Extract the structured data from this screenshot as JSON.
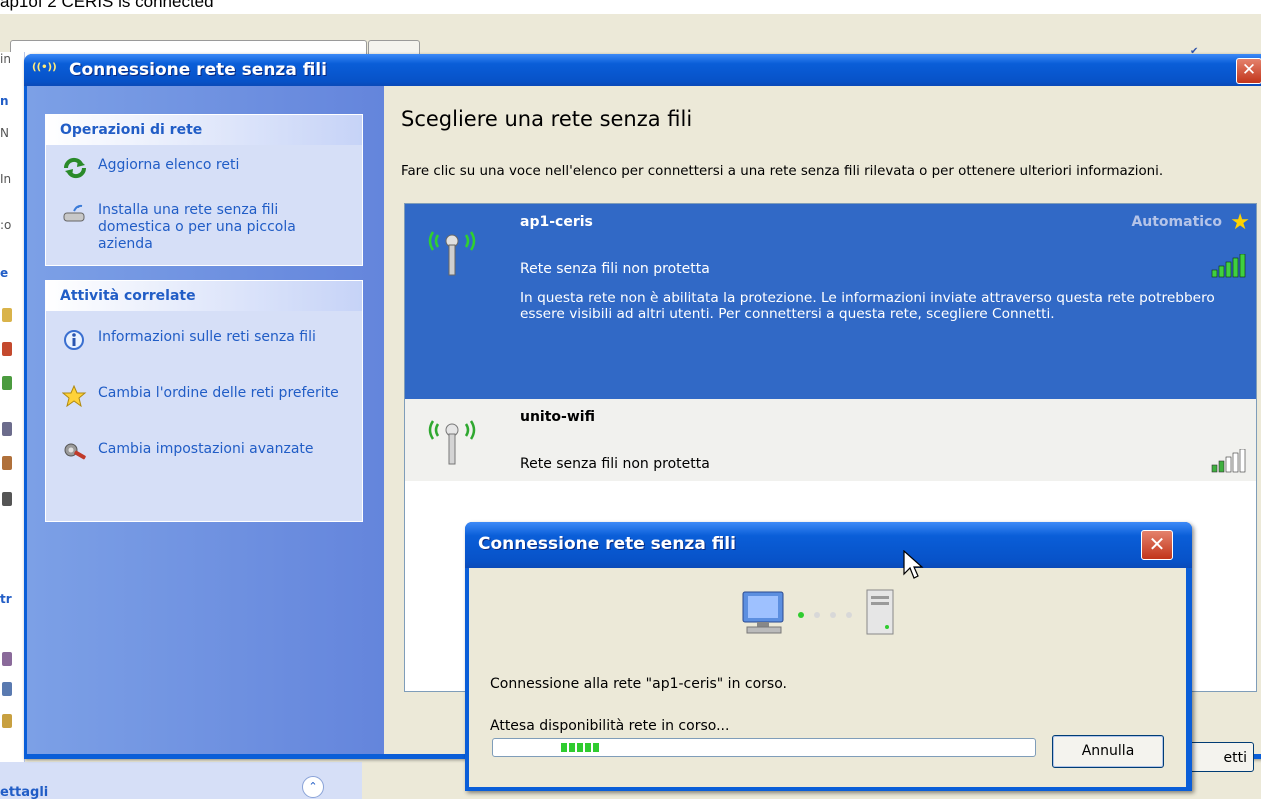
{
  "caption": "ap1of 2 CERIS is connected",
  "background": {
    "fragments": [
      "in",
      "n",
      "N",
      "In",
      ":o",
      "e",
      "tr"
    ],
    "bottom_label": "ettagli",
    "chevron": "⌃"
  },
  "window": {
    "title": "Connessione rete senza fili",
    "close": "✕",
    "sidebar": {
      "groups": [
        {
          "title": "Operazioni di rete",
          "items": [
            {
              "label": "Aggiorna elenco reti",
              "icon": "refresh-icon"
            },
            {
              "label": "Installa una rete senza fili domestica o per una piccola azienda",
              "icon": "setup-wireless-icon"
            }
          ]
        },
        {
          "title": "Attività correlate",
          "items": [
            {
              "label": "Informazioni sulle reti senza fili",
              "icon": "info-icon"
            },
            {
              "label": "Cambia l'ordine delle reti preferite",
              "icon": "star-icon"
            },
            {
              "label": "Cambia impostazioni avanzate",
              "icon": "settings-tools-icon"
            }
          ]
        }
      ]
    },
    "main": {
      "heading": "Scegliere una rete senza fili",
      "instructions": "Fare clic su una voce nell'elenco per connettersi a una rete senza fili rilevata o per ottenere ulteriori informazioni.",
      "networks": [
        {
          "name": "ap1-ceris",
          "status": "Rete senza fili non protetta",
          "connection_mode": "Automatico",
          "description": "In questa rete non è abilitata la protezione. Le informazioni inviate attraverso questa rete potrebbero essere visibili ad altri utenti. Per connettersi a questa rete, scegliere Connetti.",
          "signal_bars": 5,
          "selected": true
        },
        {
          "name": "unito-wifi",
          "status": "Rete senza fili non protetta",
          "signal_bars": 2,
          "selected": false
        }
      ],
      "connect_button": "etti"
    }
  },
  "dialog": {
    "title": "Connessione rete senza fili",
    "close": "✕",
    "message": "Connessione alla rete \"ap1-ceris\" in corso.",
    "status": "Attesa disponibilità rete in corso...",
    "cancel_label": "Annulla",
    "progress_segments": 5
  },
  "colors": {
    "title_blue": "#0a5ed8",
    "task_link": "#215dc6",
    "selection": "#3169c6",
    "progress_green": "#2fcc2f"
  }
}
